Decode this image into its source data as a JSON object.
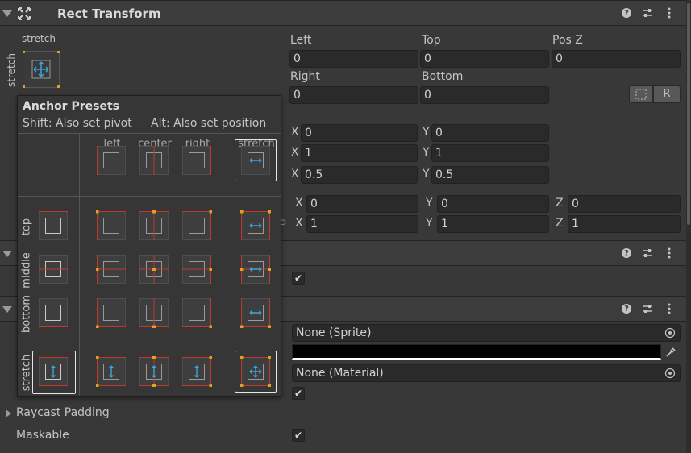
{
  "rect_transform": {
    "title": "Rect Transform",
    "anchor_h": "stretch",
    "anchor_v": "stretch",
    "left_label": "Left",
    "left_value": "0",
    "top_label": "Top",
    "top_value": "0",
    "posz_label": "Pos Z",
    "posz_value": "0",
    "right_label": "Right",
    "right_value": "0",
    "bottom_label": "Bottom",
    "bottom_value": "0",
    "raw_button": "R",
    "anchor_min": {
      "x_label": "X",
      "x": "0",
      "y_label": "Y",
      "y": "0"
    },
    "anchor_max": {
      "x_label": "X",
      "x": "1",
      "y_label": "Y",
      "y": "1"
    },
    "pivot": {
      "x_label": "X",
      "x": "0.5",
      "y_label": "Y",
      "y": "0.5"
    },
    "rotation": {
      "x_label": "X",
      "x": "0",
      "y_label": "Y",
      "y": "0",
      "z_label": "Z",
      "z": "0"
    },
    "scale": {
      "x_label": "X",
      "x": "1",
      "y_label": "Y",
      "y": "1",
      "z_label": "Z",
      "z": "1"
    }
  },
  "image": {
    "sprite_value": "None (Sprite)",
    "material_value": "None (Material)",
    "raycast_padding_label": "Raycast Padding",
    "maskable_label": "Maskable",
    "color": "#000000"
  },
  "anchor_presets": {
    "title": "Anchor Presets",
    "hint_pivot": "Shift: Also set pivot",
    "hint_position": "Alt: Also set position",
    "columns": [
      "left",
      "center",
      "right",
      "stretch"
    ],
    "rows": [
      "top",
      "middle",
      "bottom",
      "stretch"
    ],
    "selected": "stretch-stretch"
  },
  "colors": {
    "accent": "#3aa8d8",
    "anchor_red": "#c0392b",
    "anchor_dot": "#e0a020"
  }
}
